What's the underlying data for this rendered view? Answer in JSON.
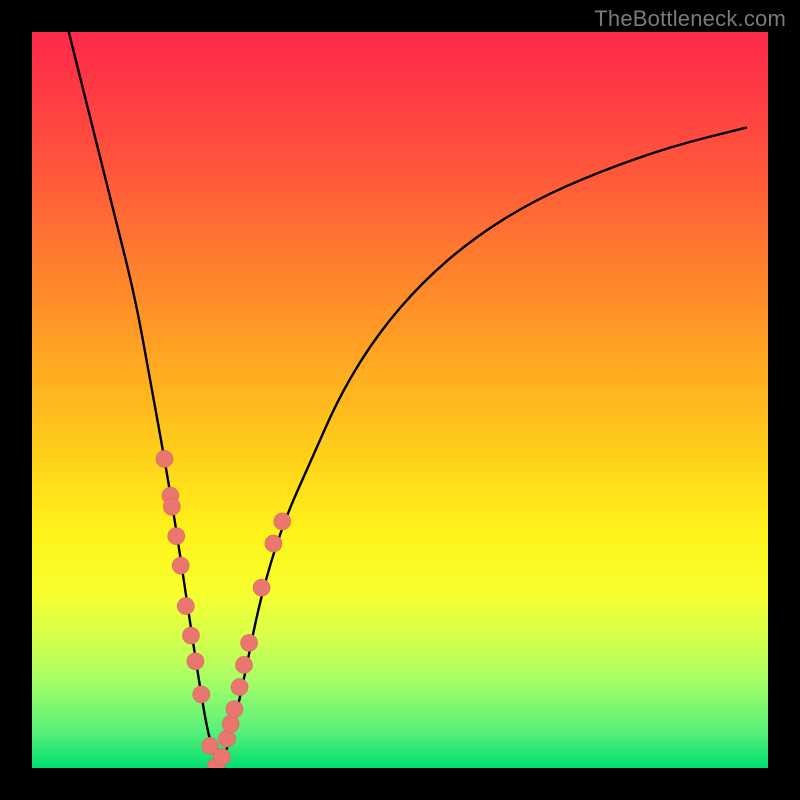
{
  "watermark": "TheBottleneck.com",
  "colors": {
    "frame": "#000000",
    "curve_stroke": "#000000",
    "marker_fill": "#e9776f",
    "marker_stroke": "#d86860"
  },
  "chart_data": {
    "type": "line",
    "title": "",
    "xlabel": "",
    "ylabel": "",
    "xlim": [
      0,
      100
    ],
    "ylim": [
      0,
      100
    ],
    "grid": false,
    "legend": false,
    "series": [
      {
        "name": "bottleneck-curve",
        "x": [
          5,
          8,
          11,
          14,
          16,
          18,
          19.5,
          21,
          22.5,
          24,
          25.5,
          27,
          29,
          31,
          34,
          38,
          42,
          47,
          53,
          60,
          68,
          77,
          87,
          97
        ],
        "values": [
          100,
          88,
          76,
          64,
          53,
          42,
          33,
          23,
          13,
          4,
          0,
          4,
          13,
          23,
          33,
          42,
          51,
          59,
          66,
          72,
          77,
          81,
          84.5,
          87
        ]
      }
    ],
    "markers": {
      "name": "highlight-points",
      "x": [
        18.0,
        18.8,
        19.0,
        19.6,
        20.2,
        20.9,
        21.6,
        22.2,
        23.0,
        24.2,
        25.0,
        25.8,
        26.5,
        27.0,
        27.5,
        28.2,
        28.8,
        29.5,
        31.2,
        32.8,
        34.0
      ],
      "values": [
        42.0,
        37.0,
        35.5,
        31.5,
        27.5,
        22.0,
        18.0,
        14.5,
        10.0,
        3.0,
        0.2,
        1.5,
        4.0,
        6.0,
        8.0,
        11.0,
        14.0,
        17.0,
        24.5,
        30.5,
        33.5
      ]
    }
  }
}
